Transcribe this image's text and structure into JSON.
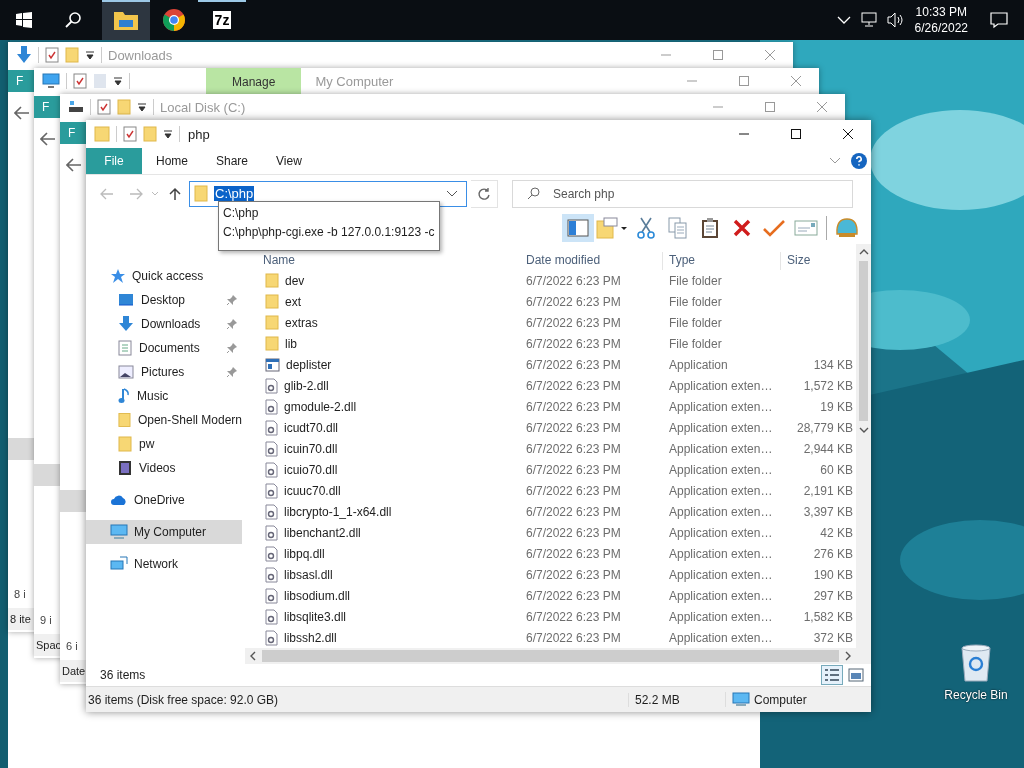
{
  "taskbar": {
    "apps": [
      {
        "kind": "explorer",
        "running": true,
        "selected": true
      },
      {
        "kind": "chrome",
        "running": false,
        "selected": false
      },
      {
        "kind": "sevenzip",
        "label": "7z",
        "running": true,
        "selected": false
      }
    ],
    "tray": {
      "time": "10:33 PM",
      "date": "6/26/2022"
    }
  },
  "desktop": {
    "icons": [
      {
        "label": "Recycle Bin"
      }
    ]
  },
  "background_windows": [
    {
      "title": "Downloads",
      "kind": "downloads",
      "tab": "F",
      "item_count": "8 i",
      "status": "8 ite"
    },
    {
      "title": "My Computer",
      "kind": "computer",
      "contextual_tab": "Manage",
      "tab": "F",
      "item_count": "9 i",
      "status": "Spac"
    },
    {
      "title": "Local Disk (C:)",
      "kind": "drive",
      "tab": "F",
      "item_count": "6 i",
      "status": "Date"
    }
  ],
  "window": {
    "title": "php",
    "ribbon_tabs": [
      {
        "label": "File",
        "kind": "file"
      },
      {
        "label": "Home",
        "kind": "tab"
      },
      {
        "label": "Share",
        "kind": "tab"
      },
      {
        "label": "View",
        "kind": "tab"
      }
    ],
    "address": {
      "value": "C:\\php",
      "text_selected": true,
      "suggestions": [
        "C:\\php",
        "C:\\php\\php-cgi.exe -b 127.0.0.1:9123 -c"
      ]
    },
    "search": {
      "placeholder": "Search php"
    },
    "preview_pane": {
      "on": true
    },
    "toolbar": [
      {
        "kind": "folder"
      },
      {
        "kind": "cut"
      },
      {
        "kind": "copy"
      },
      {
        "kind": "paste"
      },
      {
        "kind": "delete"
      },
      {
        "kind": "check"
      },
      {
        "kind": "envelope"
      },
      {
        "kind": "shell"
      }
    ],
    "nav": [
      {
        "label": "Quick access",
        "kind": "star",
        "selected": false,
        "children": [
          {
            "label": "Desktop",
            "kind": "desktop",
            "pinned": true,
            "selected": false
          },
          {
            "label": "Downloads",
            "kind": "download",
            "pinned": true,
            "selected": false
          },
          {
            "label": "Documents",
            "kind": "document",
            "pinned": true,
            "selected": false
          },
          {
            "label": "Pictures",
            "kind": "picture",
            "pinned": true,
            "selected": false
          },
          {
            "label": "Music",
            "kind": "music",
            "pinned": false,
            "selected": false
          },
          {
            "label": "Open-Shell Modern",
            "kind": "folder",
            "pinned": false,
            "selected": false
          },
          {
            "label": "pw",
            "kind": "folder",
            "pinned": false,
            "selected": false
          },
          {
            "label": "Videos",
            "kind": "video",
            "pinned": false,
            "selected": false
          }
        ]
      },
      {
        "label": "OneDrive",
        "kind": "cloud",
        "selected": false
      },
      {
        "label": "My Computer",
        "kind": "computer",
        "selected": true
      },
      {
        "label": "Network",
        "kind": "network",
        "selected": false
      }
    ],
    "columns": [
      "Name",
      "Date modified",
      "Type",
      "Size"
    ],
    "rows": [
      {
        "name": "dev",
        "kind": "folder",
        "date": "6/7/2022 6:23 PM",
        "type": "File folder"
      },
      {
        "name": "ext",
        "kind": "folder",
        "date": "6/7/2022 6:23 PM",
        "type": "File folder"
      },
      {
        "name": "extras",
        "kind": "folder",
        "date": "6/7/2022 6:23 PM",
        "type": "File folder"
      },
      {
        "name": "lib",
        "kind": "folder",
        "date": "6/7/2022 6:23 PM",
        "type": "File folder"
      },
      {
        "name": "deplister",
        "kind": "app",
        "date": "6/7/2022 6:23 PM",
        "type": "Application",
        "size": "134 KB"
      },
      {
        "name": "glib-2.dll",
        "kind": "dll",
        "date": "6/7/2022 6:23 PM",
        "type": "Application exten…",
        "size": "1,572 KB"
      },
      {
        "name": "gmodule-2.dll",
        "kind": "dll",
        "date": "6/7/2022 6:23 PM",
        "type": "Application exten…",
        "size": "19 KB"
      },
      {
        "name": "icudt70.dll",
        "kind": "dll",
        "date": "6/7/2022 6:23 PM",
        "type": "Application exten…",
        "size": "28,779 KB"
      },
      {
        "name": "icuin70.dll",
        "kind": "dll",
        "date": "6/7/2022 6:23 PM",
        "type": "Application exten…",
        "size": "2,944 KB"
      },
      {
        "name": "icuio70.dll",
        "kind": "dll",
        "date": "6/7/2022 6:23 PM",
        "type": "Application exten…",
        "size": "60 KB"
      },
      {
        "name": "icuuc70.dll",
        "kind": "dll",
        "date": "6/7/2022 6:23 PM",
        "type": "Application exten…",
        "size": "2,191 KB"
      },
      {
        "name": "libcrypto-1_1-x64.dll",
        "kind": "dll",
        "date": "6/7/2022 6:23 PM",
        "type": "Application exten…",
        "size": "3,397 KB"
      },
      {
        "name": "libenchant2.dll",
        "kind": "dll",
        "date": "6/7/2022 6:23 PM",
        "type": "Application exten…",
        "size": "42 KB"
      },
      {
        "name": "libpq.dll",
        "kind": "dll",
        "date": "6/7/2022 6:23 PM",
        "type": "Application exten…",
        "size": "276 KB"
      },
      {
        "name": "libsasl.dll",
        "kind": "dll",
        "date": "6/7/2022 6:23 PM",
        "type": "Application exten…",
        "size": "190 KB"
      },
      {
        "name": "libsodium.dll",
        "kind": "dll",
        "date": "6/7/2022 6:23 PM",
        "type": "Application exten…",
        "size": "297 KB"
      },
      {
        "name": "libsqlite3.dll",
        "kind": "dll",
        "date": "6/7/2022 6:23 PM",
        "type": "Application exten…",
        "size": "1,582 KB"
      },
      {
        "name": "libssh2.dll",
        "kind": "dll",
        "date": "6/7/2022 6:23 PM",
        "type": "Application exten…",
        "size": "372 KB"
      }
    ],
    "item_count": "36 items",
    "status": {
      "summary": "36 items (Disk free space: 92.0 GB)",
      "size": "52.2 MB",
      "zone": "Computer"
    }
  }
}
